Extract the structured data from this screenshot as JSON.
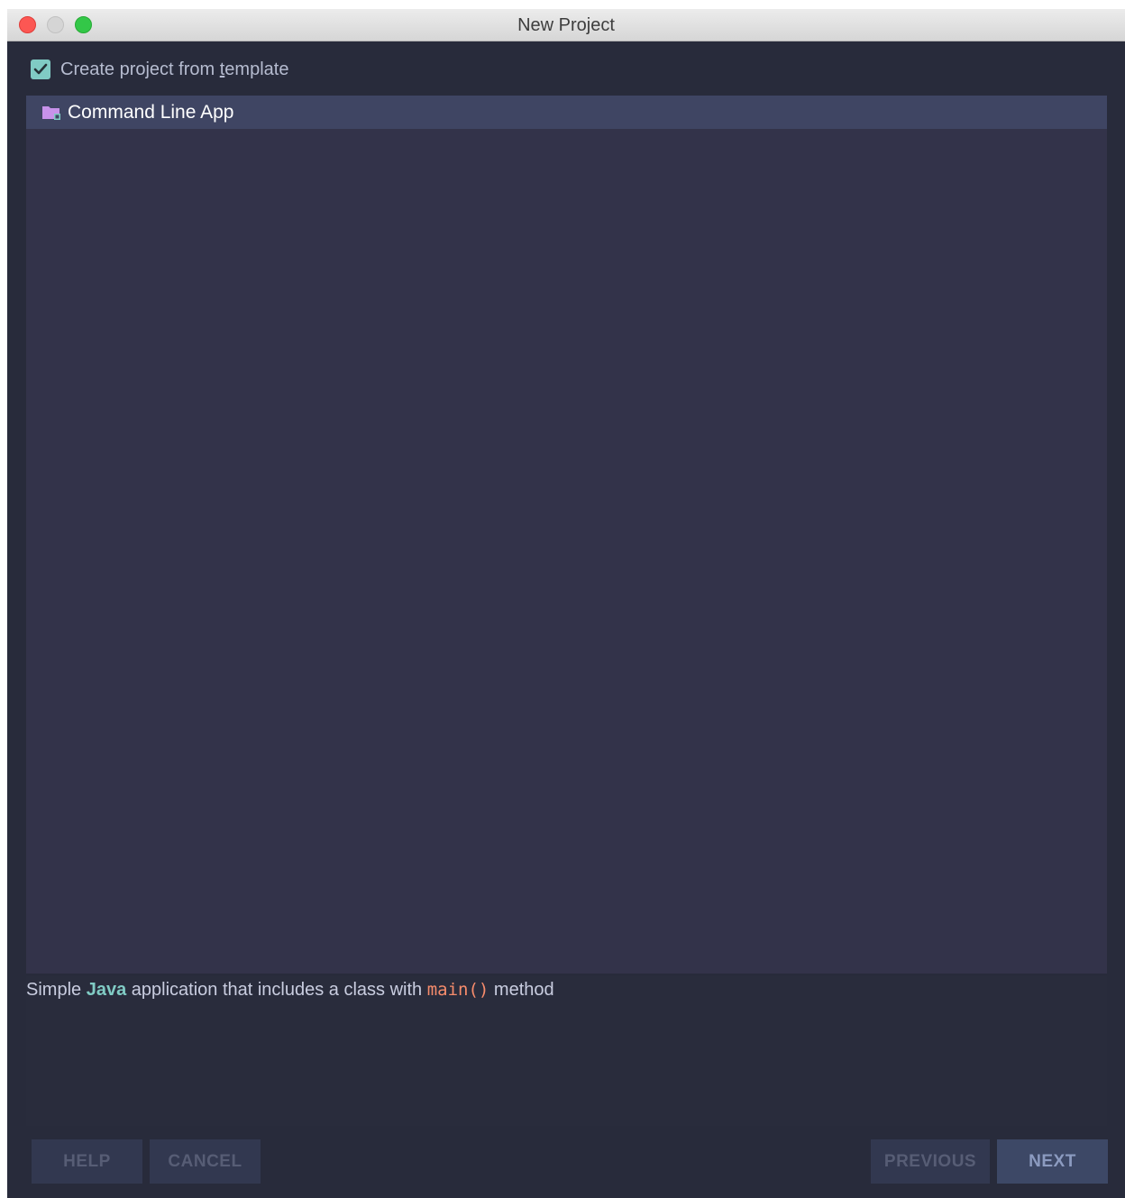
{
  "window": {
    "title": "New Project"
  },
  "template_option": {
    "checkbox_checked": true,
    "label_before": "Create project from ",
    "label_underlined": "t",
    "label_after": "emplate"
  },
  "template_list": {
    "items": [
      {
        "label": "Command Line App",
        "icon": "folder-icon",
        "selected": true
      }
    ]
  },
  "description": {
    "part1": "Simple ",
    "part2": "Java",
    "part3": " application that includes a class with ",
    "part4": "main()",
    "part5": " method"
  },
  "buttons": {
    "help": "HELP",
    "cancel": "CANCEL",
    "previous": "PREVIOUS",
    "next": "NEXT"
  },
  "colors": {
    "accent": "#80cbc4",
    "highlight": "#f78c6c",
    "background": "#282b3b",
    "list_background": "#33334a",
    "selected_row": "#3f4563"
  }
}
